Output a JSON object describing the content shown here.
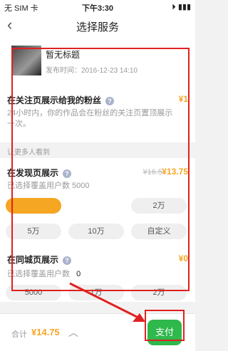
{
  "status_bar": {
    "carrier": "无 SIM 卡",
    "time": "下午3:30",
    "battery": ""
  },
  "nav": {
    "title": "选择服务"
  },
  "post": {
    "title": "暂无标题",
    "date": "发布时间：2016-12-23 14:10"
  },
  "fans": {
    "title": "在关注页展示给我的粉丝",
    "price": "¥1",
    "desc": "24小时内，你的作品会在粉丝的关注页置顶展示一次。"
  },
  "more_people": {
    "label": "让更多人看到"
  },
  "discover": {
    "title": "在发现页展示",
    "old_price": "¥16.5",
    "price": "¥13.75",
    "cover_label": "已选择覆盖用户数 5000",
    "options": [
      "",
      "2万",
      "5万",
      "10万",
      "自定义"
    ]
  },
  "local": {
    "title": "在同城页展示",
    "price": "¥0",
    "cover_label": "已选择覆盖用户数",
    "cover_value": "0",
    "options": [
      "5000",
      "1万",
      "2万"
    ]
  },
  "footer": {
    "total_label": "合计",
    "total_value": "¥14.75",
    "pay_label": "支付"
  },
  "colors": {
    "accent": "#f5a623",
    "pay": "#2fb84c",
    "annotation": "#e02020"
  }
}
